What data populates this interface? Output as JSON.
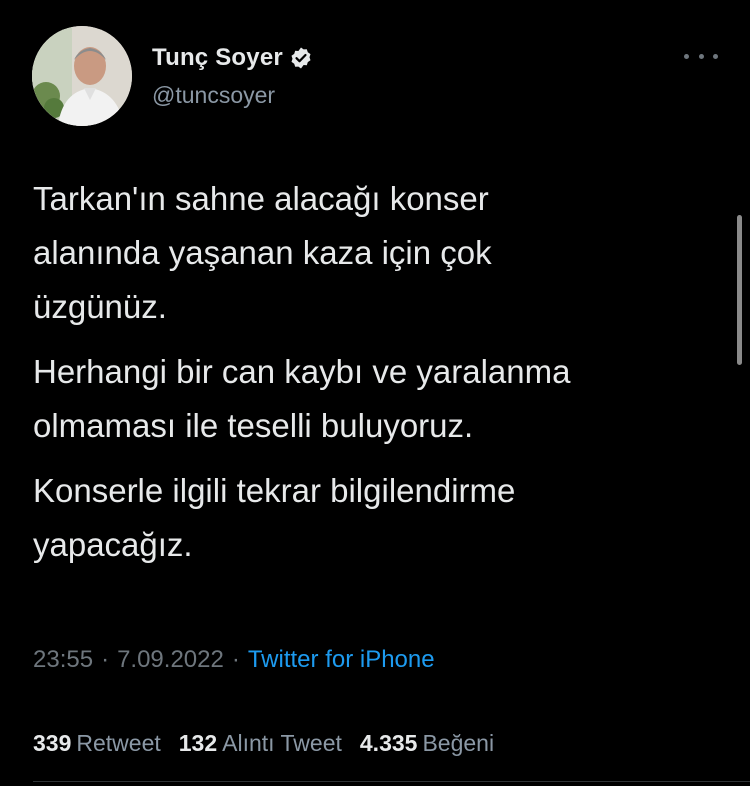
{
  "author": {
    "display_name": "Tunç Soyer",
    "handle": "@tuncsoyer",
    "verified": true
  },
  "tweet": {
    "paragraphs": [
      "Tarkan'ın sahne alacağı konser\nalanında yaşanan kaza için çok\nüzgünüz.",
      "Herhangi bir can kaybı ve yaralanma\nolmaması ile teselli buluyoruz.",
      "Konserle ilgili tekrar bilgilendirme\nyapacağız."
    ]
  },
  "meta": {
    "time": "23:55",
    "separator": "·",
    "date": "7.09.2022",
    "source": "Twitter for iPhone"
  },
  "stats": {
    "retweets_count": "339",
    "retweets_label": "Retweet",
    "quotes_count": "132",
    "quotes_label": "Alıntı Tweet",
    "likes_count": "4.335",
    "likes_label": "Beğeni"
  },
  "icons": {
    "verified": "verified-badge-icon",
    "more": "more-options-icon"
  },
  "colors": {
    "background": "#000000",
    "text_primary": "#e7e9ea",
    "text_secondary": "#6e767d",
    "link": "#1d9bf0"
  }
}
